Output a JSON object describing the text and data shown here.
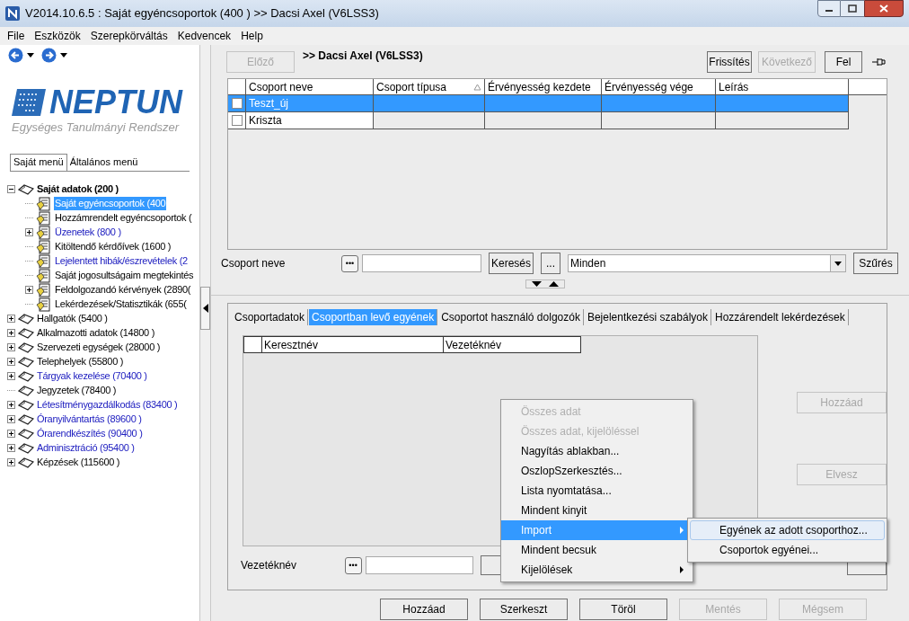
{
  "window": {
    "title": "V2014.10.6.5 : Saját egyéncsoportok (400  ) >> Dacsi Axel (V6LSS3)"
  },
  "menu_bar": [
    "File",
    "Eszközök",
    "Szerepkörváltás",
    "Kedvencek",
    "Help"
  ],
  "logo": {
    "name": "NEPTUN",
    "tagline": "Egységes Tanulmányi Rendszer"
  },
  "sidebar": {
    "tabs": [
      {
        "label": "Saját menü",
        "selected": true
      },
      {
        "label": "Általános menü",
        "selected": false
      }
    ],
    "tree": [
      {
        "label": "Saját adatok (200  )",
        "kind": "book",
        "expanded": true,
        "bold": true,
        "link": false,
        "selected": false,
        "children": [
          {
            "label": "Saját egyéncsoportok (400",
            "kind": "document",
            "selected": true
          },
          {
            "label": "Hozzámrendelt egyéncsoportok (",
            "kind": "document",
            "selected": false,
            "link": false
          },
          {
            "label": "Üzenetek (800  )",
            "kind": "document",
            "expanded": false,
            "selected": false,
            "link": true
          },
          {
            "label": "Kitöltendő kérdőívek (1600  )",
            "kind": "document",
            "selected": false,
            "link": false
          },
          {
            "label": "Lejelentett hibák/észrevételek (2",
            "kind": "document",
            "selected": false,
            "link": true
          },
          {
            "label": "Saját jogosultságaim megtekintés",
            "kind": "document",
            "selected": false,
            "link": false
          },
          {
            "label": "Feldolgozandó kérvények (2890(",
            "kind": "document",
            "expanded": false,
            "selected": false,
            "link": false
          },
          {
            "label": "Lekérdezések/Statisztikák  (655(",
            "kind": "document",
            "selected": false,
            "link": false
          }
        ]
      },
      {
        "label": "Hallgatók (5400  )",
        "kind": "book",
        "expanded": false,
        "selected": false,
        "link": false
      },
      {
        "label": "Alkalmazotti adatok (14800  )",
        "kind": "book",
        "expanded": false,
        "selected": false,
        "link": false
      },
      {
        "label": "Szervezeti egységek (28000  )",
        "kind": "book",
        "expanded": false,
        "selected": false,
        "link": false
      },
      {
        "label": "Telephelyek (55800  )",
        "kind": "book",
        "expanded": false,
        "selected": false,
        "link": false
      },
      {
        "label": "Tárgyak kezelése (70400  )",
        "kind": "book",
        "expanded": false,
        "selected": false,
        "link": true
      },
      {
        "label": "Jegyzetek (78400  )",
        "kind": "book",
        "selected": false,
        "link": false
      },
      {
        "label": "Létesítménygazdálkodás (83400  )",
        "kind": "book",
        "expanded": false,
        "selected": false,
        "link": true
      },
      {
        "label": "Óranyilvántartás (89600  )",
        "kind": "book",
        "expanded": false,
        "selected": false,
        "link": true
      },
      {
        "label": "Órarendkészítés (90400  )",
        "kind": "book",
        "expanded": false,
        "selected": false,
        "link": true
      },
      {
        "label": "Adminisztráció (95400  )",
        "kind": "book",
        "expanded": false,
        "selected": false,
        "link": true
      },
      {
        "label": "Képzések (115600  )",
        "kind": "book",
        "expanded": false,
        "selected": false,
        "link": false
      }
    ]
  },
  "header": {
    "prev": {
      "label": "Előző",
      "disabled": true
    },
    "title": ">> Dacsi Axel (V6LSS3)",
    "buttons": [
      {
        "label": "Frissítés",
        "disabled": false
      },
      {
        "label": "Következő",
        "disabled": true
      },
      {
        "label": "Fel",
        "disabled": false
      }
    ]
  },
  "groups_table": {
    "columns": [
      {
        "label": "Csoport neve",
        "sorted": false
      },
      {
        "label": "Csoport típusa",
        "sorted": true
      },
      {
        "label": "Érvényesség kezdete",
        "sorted": false
      },
      {
        "label": "Érvényesség vége",
        "sorted": false
      },
      {
        "label": "Leírás",
        "sorted": false
      }
    ],
    "rows": [
      {
        "name": "Teszt_új",
        "checked": false,
        "selected": true
      },
      {
        "name": "Kriszta",
        "checked": false,
        "selected": false
      }
    ]
  },
  "group_search": {
    "label": "Csoport neve",
    "dots": "•••",
    "search_button": "Keresés",
    "more_button": "...",
    "filter": "Minden",
    "filter_button": "Szűrés"
  },
  "detail_tabs": [
    {
      "label": "Csoportadatok",
      "selected": false
    },
    {
      "label": "Csoportban levő egyének",
      "selected": true
    },
    {
      "label": "Csoportot használó dolgozók",
      "selected": false
    },
    {
      "label": "Bejelentkezési szabályok",
      "selected": false
    },
    {
      "label": "Hozzárendelt lekérdezések",
      "selected": false
    }
  ],
  "members_table": {
    "columns": [
      "Keresztnév",
      "Vezetéknév"
    ]
  },
  "side_buttons": [
    {
      "label": "Hozzáad",
      "disabled": true
    },
    {
      "label": "Elvesz",
      "disabled": true
    }
  ],
  "member_search": {
    "label": "Vezetéknév",
    "dots": "•••"
  },
  "bottom_buttons": [
    {
      "label": "Hozzáad",
      "disabled": false
    },
    {
      "label": "Szerkeszt",
      "disabled": false
    },
    {
      "label": "Töröl",
      "disabled": false
    },
    {
      "label": "Mentés",
      "disabled": true
    },
    {
      "label": "Mégsem",
      "disabled": true
    }
  ],
  "context_menu": [
    {
      "label": "Összes adat",
      "disabled": true,
      "selected": false,
      "submenu": false
    },
    {
      "label": "Összes adat, kijelöléssel",
      "disabled": true,
      "selected": false,
      "submenu": false
    },
    {
      "label": "Nagyítás ablakban...",
      "disabled": false,
      "selected": false,
      "submenu": false
    },
    {
      "label": "OszlopSzerkesztés...",
      "disabled": false,
      "selected": false,
      "submenu": false
    },
    {
      "label": "Lista nyomtatása...",
      "disabled": false,
      "selected": false,
      "submenu": false
    },
    {
      "label": "Mindent kinyit",
      "disabled": false,
      "selected": false,
      "submenu": false
    },
    {
      "label": "Import",
      "disabled": false,
      "selected": true,
      "submenu": true
    },
    {
      "label": "Mindent becsuk",
      "disabled": false,
      "selected": false,
      "submenu": false
    },
    {
      "label": "Kijelölések",
      "disabled": false,
      "selected": false,
      "submenu": true
    }
  ],
  "submenu": [
    {
      "label": "Egyének az adott csoporthoz...",
      "selected": true
    },
    {
      "label": "Csoportok egyénei...",
      "selected": false
    }
  ]
}
